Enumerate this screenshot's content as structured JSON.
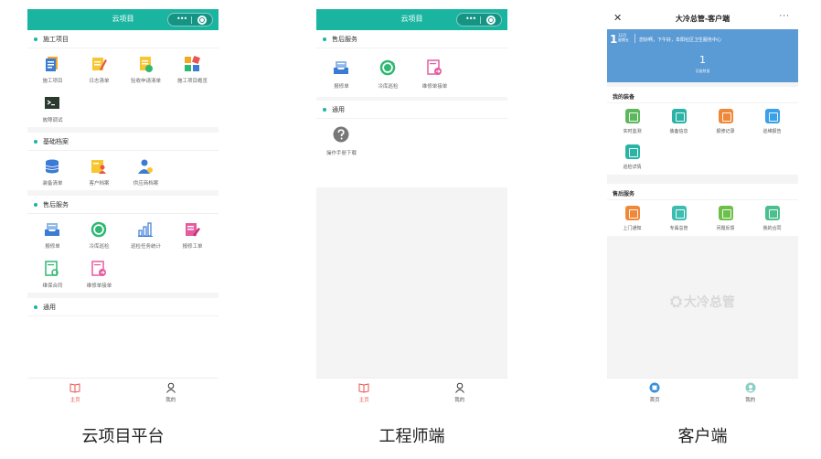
{
  "phone1": {
    "title": "云项目",
    "sections": [
      {
        "label": "施工项目",
        "items": [
          "施工项目",
          "日志清单",
          "验收申请清单",
          "施工项目概览",
          "故障调试"
        ]
      },
      {
        "label": "基础档案",
        "items": [
          "装备清单",
          "客户档案",
          "供应商档案"
        ]
      },
      {
        "label": "售后服务",
        "items": [
          "报修单",
          "冷库巡检",
          "巡检任务统计",
          "报修工单",
          "维保合同",
          "维修单接单"
        ]
      },
      {
        "label": "通用",
        "items": []
      }
    ],
    "tabs": [
      "主页",
      "我的"
    ],
    "caption": "云项目平台"
  },
  "phone2": {
    "title": "云项目",
    "sections": [
      {
        "label": "售后服务",
        "items": [
          "报修单",
          "冷库巡检",
          "维修单接单"
        ]
      },
      {
        "label": "通用",
        "items": [
          "操作手册下载"
        ]
      }
    ],
    "tabs": [
      "主页",
      "我的"
    ],
    "caption": "工程师端"
  },
  "phone3": {
    "close_glyph": "✕",
    "title": "大冷总管-客户端",
    "more_glyph": "···",
    "banner": {
      "day": "1",
      "date_line1": "12月",
      "date_line2": "星期五",
      "message": "您好啊，下午好，阜阳社区卫生服务中心",
      "count": "1",
      "count_label": "设备数量"
    },
    "equipment": {
      "heading": "我的装备",
      "items": [
        "实时监测",
        "装备信息",
        "报修记录",
        "巡维报告",
        "巡检详情"
      ]
    },
    "service": {
      "heading": "售后服务",
      "items": [
        "上门通知",
        "专属总管",
        "问题反馈",
        "我的合同"
      ]
    },
    "logo_text": "大冷总管",
    "tabs": [
      "首页",
      "我的"
    ],
    "caption": "客户端"
  },
  "colors": {
    "teal": "#1ab5a1",
    "banner_blue": "#5a9ad5",
    "active_tab": "#e8554e"
  }
}
